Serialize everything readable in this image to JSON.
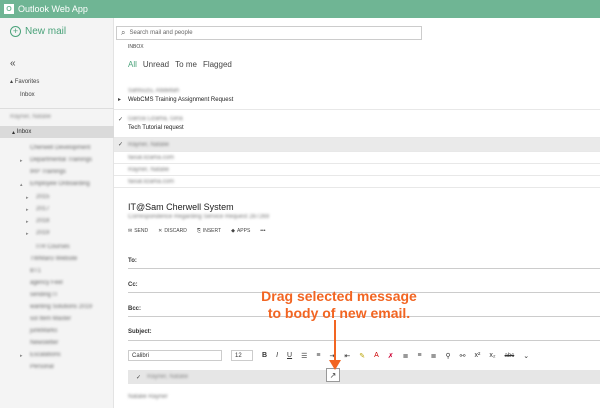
{
  "app": {
    "title": "Outlook Web App"
  },
  "left": {
    "new_mail": "New mail",
    "favorites": "Favorites",
    "fav_inbox": "Inbox",
    "account": "Rayner, Natalie",
    "inbox": "Inbox",
    "folders": [
      "Cherwell Development",
      "Departmental Trainings",
      "IRP Trainings",
      "Employee Onboarding",
      "2015",
      "2017",
      "2018",
      "2019",
      "ITR Courses",
      "TWMarci Website",
      "BT1",
      "agency Feel",
      "sending IT",
      "wanting Solutions 2019",
      "sol Item Master",
      "junkMarks",
      "Newsletter",
      "Escalations",
      "Personal"
    ]
  },
  "main": {
    "search_placeholder": "Search mail and people",
    "inbox_label": "INBOX",
    "filters": [
      "All",
      "Unread",
      "To me",
      "Flagged"
    ],
    "messages": [
      {
        "sender": "Sahlsuzu, Abdellah",
        "subject": "WebCMS Training Assignment Request"
      },
      {
        "sender": "Garcia Lizama, Gina",
        "subject": "Tech Tutorial request"
      },
      {
        "sender": "Rayner, Natalie",
        "subject": ""
      },
      {
        "sender": "faisal.lizama.com",
        "subject": ""
      },
      {
        "sender": "Rayner, Natalie",
        "subject": ""
      },
      {
        "sender": "faisal.lizama.com",
        "subject": ""
      }
    ],
    "compose_title": "IT@Sam Cherwell System",
    "compose_sub": "Correspondence Regarding Service Request 287269",
    "toolbar": {
      "send": "SEND",
      "discard": "DISCARD",
      "insert": "INSERT",
      "apps": "APPS",
      "more": "•••"
    },
    "fields": {
      "to": "To:",
      "cc": "Cc:",
      "bcc": "Bcc:",
      "subject": "Subject:"
    },
    "font": "Calibri",
    "size": "12",
    "fmt_buttons": [
      "B",
      "I",
      "U",
      "x²",
      "x₂",
      "abc"
    ],
    "attach_sender": "Rayner, Natalie",
    "signature": "Natalie Rayner"
  },
  "annotation": {
    "line1": "Drag selected message",
    "line2": "to body of new email."
  }
}
